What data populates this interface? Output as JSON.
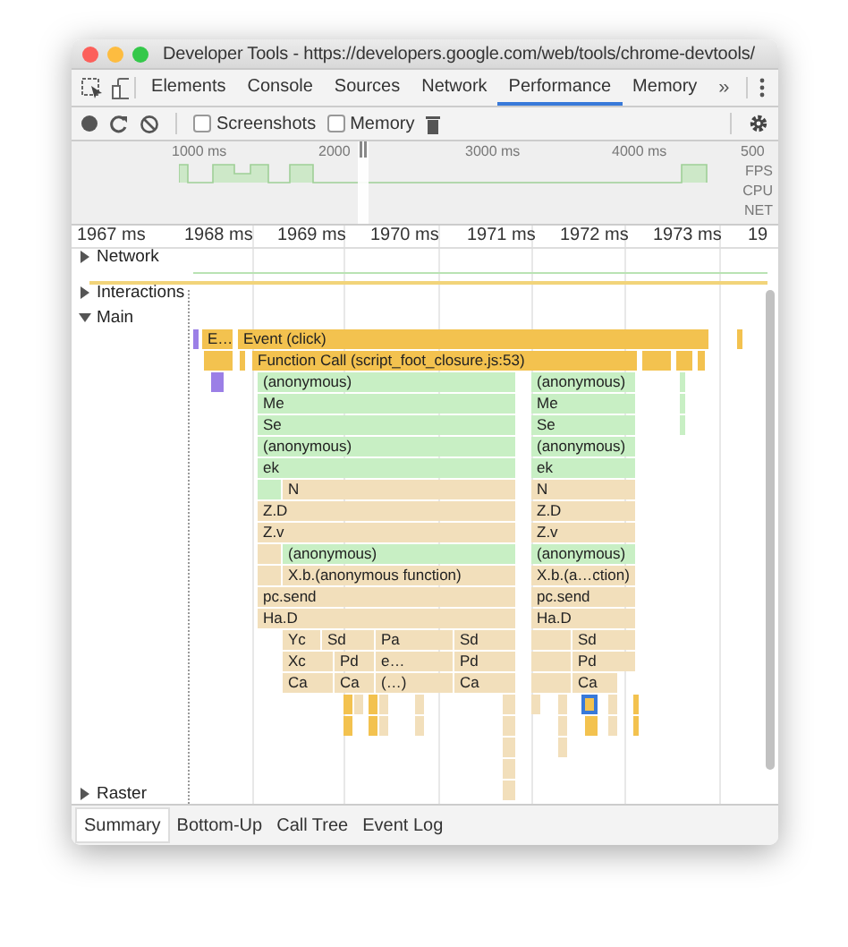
{
  "window": {
    "title": "Developer Tools - https://developers.google.com/web/tools/chrome-devtools/"
  },
  "tabs": [
    {
      "label": "Elements",
      "selected": false
    },
    {
      "label": "Console",
      "selected": false
    },
    {
      "label": "Sources",
      "selected": false
    },
    {
      "label": "Network",
      "selected": false
    },
    {
      "label": "Performance",
      "selected": true
    },
    {
      "label": "Memory",
      "selected": false
    }
  ],
  "tabs_overflow": "»",
  "toolbar": {
    "checkboxes": [
      {
        "label": "Screenshots",
        "checked": false
      },
      {
        "label": "Memory",
        "checked": false
      }
    ]
  },
  "overview": {
    "ticks": [
      "1000 ms",
      "2000",
      "3000 ms",
      "4000 ms",
      "500"
    ],
    "lanes": [
      "FPS",
      "CPU",
      "NET"
    ]
  },
  "ruler": {
    "ticks": [
      "1967 ms",
      "1968 ms",
      "1969 ms",
      "1970 ms",
      "1971 ms",
      "1972 ms",
      "1973 ms",
      "19"
    ]
  },
  "tracks": [
    {
      "label": "Network",
      "expanded": false
    },
    {
      "label": "Interactions",
      "expanded": false
    },
    {
      "label": "Main",
      "expanded": true
    },
    {
      "label": "Raster",
      "expanded": false
    }
  ],
  "flame": {
    "blocks": [
      {
        "kind": "paint",
        "selected": false
      },
      {
        "kind": "event",
        "label": "E…",
        "selected": false
      },
      {
        "kind": "event",
        "label": "Event (click)",
        "selected": false
      },
      {
        "kind": "event",
        "selected": false
      },
      {
        "kind": "script",
        "selected": false
      },
      {
        "kind": "script",
        "selected": false
      },
      {
        "kind": "script",
        "label": "Function Call (script_foot_closure.js:53)",
        "selected": false
      },
      {
        "kind": "script",
        "selected": false
      },
      {
        "kind": "script",
        "selected": false
      },
      {
        "kind": "script",
        "selected": false
      },
      {
        "kind": "paint",
        "selected": false
      },
      {
        "kind": "lib",
        "label": "(anonymous)",
        "selected": false
      },
      {
        "kind": "lib",
        "label": "(anonymous)",
        "selected": false
      },
      {
        "kind": "lib",
        "selected": false
      },
      {
        "kind": "lib",
        "label": "Me",
        "selected": false
      },
      {
        "kind": "lib",
        "label": "Me",
        "selected": false
      },
      {
        "kind": "lib",
        "selected": false
      },
      {
        "kind": "lib",
        "label": "Se",
        "selected": false
      },
      {
        "kind": "lib",
        "label": "Se",
        "selected": false
      },
      {
        "kind": "lib",
        "selected": false
      },
      {
        "kind": "lib",
        "label": "(anonymous)",
        "selected": false
      },
      {
        "kind": "lib",
        "label": "(anonymous)",
        "selected": false
      },
      {
        "kind": "lib",
        "label": "ek",
        "selected": false
      },
      {
        "kind": "lib",
        "label": "ek",
        "selected": false
      },
      {
        "kind": "lib",
        "selected": false
      },
      {
        "kind": "app",
        "label": "N",
        "selected": false
      },
      {
        "kind": "app",
        "label": "N",
        "selected": false
      },
      {
        "kind": "app",
        "label": "Z.D",
        "selected": false
      },
      {
        "kind": "app",
        "label": "Z.D",
        "selected": false
      },
      {
        "kind": "app",
        "label": "Z.v",
        "selected": false
      },
      {
        "kind": "app",
        "label": "Z.v",
        "selected": false
      },
      {
        "kind": "app",
        "selected": false
      },
      {
        "kind": "lib",
        "label": "(anonymous)",
        "selected": false
      },
      {
        "kind": "lib",
        "label": "(anonymous)",
        "selected": false
      },
      {
        "kind": "app",
        "selected": false
      },
      {
        "kind": "app",
        "label": "X.b.(anonymous function)",
        "selected": false
      },
      {
        "kind": "app",
        "label": "X.b.(a…ction)",
        "selected": false
      },
      {
        "kind": "app",
        "label": "pc.send",
        "selected": false
      },
      {
        "kind": "app",
        "label": "pc.send",
        "selected": false
      },
      {
        "kind": "app",
        "label": "Ha.D",
        "selected": false
      },
      {
        "kind": "app",
        "label": "Ha.D",
        "selected": false
      },
      {
        "kind": "app",
        "label": "Yc",
        "selected": false
      },
      {
        "kind": "app",
        "label": "Sd",
        "selected": false
      },
      {
        "kind": "app",
        "label": "Pa",
        "selected": false
      },
      {
        "kind": "app",
        "label": "Sd",
        "selected": false
      },
      {
        "kind": "app",
        "selected": false
      },
      {
        "kind": "app",
        "label": "Sd",
        "selected": false
      },
      {
        "kind": "app",
        "label": "Xc",
        "selected": false
      },
      {
        "kind": "app",
        "label": "Pd",
        "selected": false
      },
      {
        "kind": "app",
        "label": "e…",
        "selected": false
      },
      {
        "kind": "app",
        "label": "Pd",
        "selected": false
      },
      {
        "kind": "app",
        "selected": false
      },
      {
        "kind": "app",
        "label": "Pd",
        "selected": false
      },
      {
        "kind": "app",
        "label": "Ca",
        "selected": false
      },
      {
        "kind": "app",
        "label": "Ca",
        "selected": false
      },
      {
        "kind": "app",
        "label": "(…)",
        "selected": false
      },
      {
        "kind": "app",
        "label": "Ca",
        "selected": false
      },
      {
        "kind": "app",
        "selected": false
      },
      {
        "kind": "app",
        "label": "Ca",
        "selected": false
      },
      {
        "kind": "script",
        "selected": false
      },
      {
        "kind": "app",
        "selected": false
      },
      {
        "kind": "script",
        "selected": false
      },
      {
        "kind": "app",
        "selected": false
      },
      {
        "kind": "app",
        "selected": false
      },
      {
        "kind": "app",
        "selected": false
      },
      {
        "kind": "app",
        "selected": false
      },
      {
        "kind": "app",
        "selected": false
      },
      {
        "kind": "script",
        "selected": true
      },
      {
        "kind": "app",
        "selected": false
      },
      {
        "kind": "script",
        "selected": false
      },
      {
        "kind": "script",
        "selected": false
      },
      {
        "kind": "script",
        "selected": false
      },
      {
        "kind": "app",
        "selected": false
      },
      {
        "kind": "app",
        "selected": false
      },
      {
        "kind": "app",
        "selected": false
      },
      {
        "kind": "app",
        "selected": false
      },
      {
        "kind": "script",
        "selected": false
      },
      {
        "kind": "app",
        "selected": false
      },
      {
        "kind": "script",
        "selected": false
      },
      {
        "kind": "app",
        "selected": false
      },
      {
        "kind": "app",
        "selected": false
      },
      {
        "kind": "app",
        "selected": false
      },
      {
        "kind": "app",
        "selected": false
      }
    ]
  },
  "bottom_tabs": [
    {
      "label": "Summary",
      "selected": true
    },
    {
      "label": "Bottom-Up",
      "selected": false
    },
    {
      "label": "Call Tree",
      "selected": false
    },
    {
      "label": "Event Log",
      "selected": false
    }
  ]
}
